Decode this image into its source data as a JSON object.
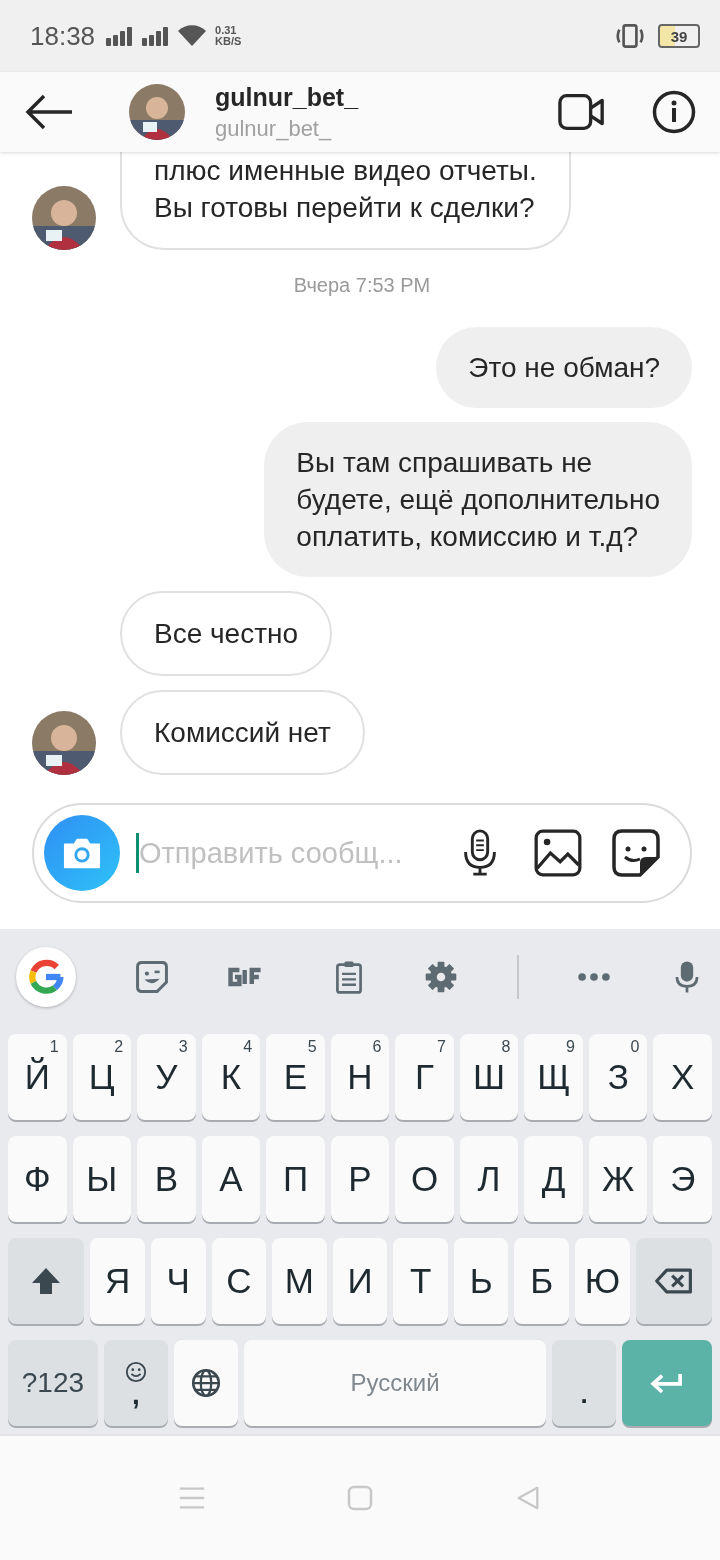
{
  "status_bar": {
    "time": "18:38",
    "speed_value": "0.31",
    "speed_unit": "KB/S",
    "battery": "39"
  },
  "header": {
    "title": "gulnur_bet_",
    "subtitle": "gulnur_bet_"
  },
  "messages": [
    {
      "kind": "received",
      "text": "плюс именные видео отчеты.\nВы готовы перейти к сделки?",
      "avatar": true
    },
    {
      "kind": "date",
      "text": "Вчера 7:53 PM"
    },
    {
      "kind": "sent",
      "text": "Это не обман?"
    },
    {
      "kind": "sent",
      "text": "Вы там спрашивать не\nбудете, ещё дополнительно\nоплатить, комиссию и т.д?"
    },
    {
      "kind": "received",
      "text": "Все честно",
      "avatar": false
    },
    {
      "kind": "received",
      "text": "Комиссий нет",
      "avatar": true
    }
  ],
  "composer": {
    "placeholder": "Отправить сообщ..."
  },
  "keyboard": {
    "rows": [
      {
        "keys": [
          {
            "kind": "letter",
            "label": "Й",
            "hint": "1"
          },
          {
            "kind": "letter",
            "label": "Ц",
            "hint": "2"
          },
          {
            "kind": "letter",
            "label": "У",
            "hint": "3"
          },
          {
            "kind": "letter",
            "label": "К",
            "hint": "4"
          },
          {
            "kind": "letter",
            "label": "Е",
            "hint": "5"
          },
          {
            "kind": "letter",
            "label": "Н",
            "hint": "6"
          },
          {
            "kind": "letter",
            "label": "Г",
            "hint": "7"
          },
          {
            "kind": "letter",
            "label": "Ш",
            "hint": "8"
          },
          {
            "kind": "letter",
            "label": "Щ",
            "hint": "9"
          },
          {
            "kind": "letter",
            "label": "З",
            "hint": "0"
          },
          {
            "kind": "letter",
            "label": "Х"
          }
        ]
      },
      {
        "keys": [
          {
            "kind": "letter",
            "label": "Ф"
          },
          {
            "kind": "letter",
            "label": "Ы"
          },
          {
            "kind": "letter",
            "label": "В"
          },
          {
            "kind": "letter",
            "label": "А"
          },
          {
            "kind": "letter",
            "label": "П"
          },
          {
            "kind": "letter",
            "label": "Р"
          },
          {
            "kind": "letter",
            "label": "О"
          },
          {
            "kind": "letter",
            "label": "Л"
          },
          {
            "kind": "letter",
            "label": "Д"
          },
          {
            "kind": "letter",
            "label": "Ж"
          },
          {
            "kind": "letter",
            "label": "Э"
          }
        ]
      },
      {
        "keys": [
          {
            "kind": "shift"
          },
          {
            "kind": "letter",
            "label": "Я"
          },
          {
            "kind": "letter",
            "label": "Ч"
          },
          {
            "kind": "letter",
            "label": "С"
          },
          {
            "kind": "letter",
            "label": "М"
          },
          {
            "kind": "letter",
            "label": "И"
          },
          {
            "kind": "letter",
            "label": "Т"
          },
          {
            "kind": "letter",
            "label": "Ь"
          },
          {
            "kind": "letter",
            "label": "Б"
          },
          {
            "kind": "letter",
            "label": "Ю"
          },
          {
            "kind": "backspace"
          }
        ]
      },
      {
        "keys": [
          {
            "kind": "symbols",
            "label": "?123"
          },
          {
            "kind": "emoji",
            "label": ","
          },
          {
            "kind": "globe"
          },
          {
            "kind": "space",
            "label": "Русский"
          },
          {
            "kind": "period",
            "label": "."
          },
          {
            "kind": "enter"
          }
        ]
      }
    ]
  }
}
